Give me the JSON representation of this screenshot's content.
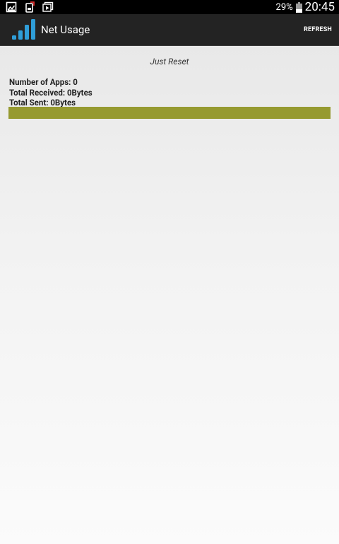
{
  "status_bar": {
    "icons": [
      "image-notification-icon",
      "android-debug-icon",
      "photo-album-icon"
    ],
    "battery_percent": "29%",
    "time": "20:45"
  },
  "action_bar": {
    "app_title": "Net Usage",
    "refresh_label": "REFRESH",
    "logo_icon": "signal-bars-icon",
    "logo_color": "#2f9ed8"
  },
  "main": {
    "status_message": "Just Reset",
    "stats": {
      "apps": "Number of Apps: 0",
      "received": "Total Received: 0Bytes",
      "sent": "Total Sent: 0Bytes"
    },
    "usage_bar_color": "#969a30"
  }
}
